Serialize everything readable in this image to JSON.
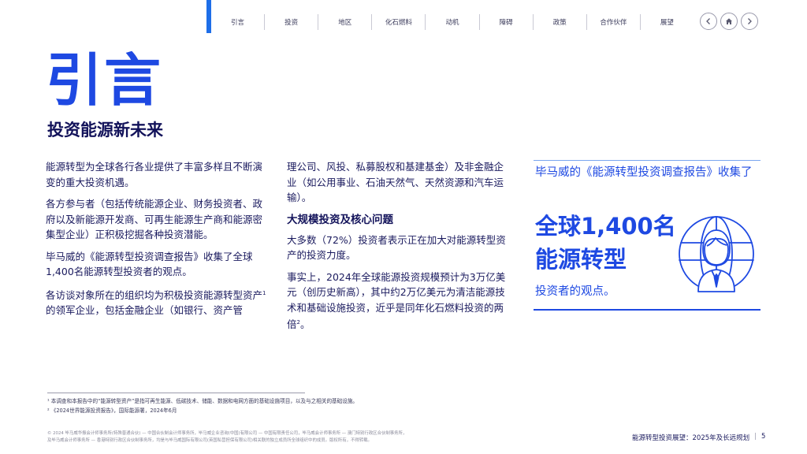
{
  "nav": {
    "items": [
      "引言",
      "投资",
      "地区",
      "化石燃料",
      "动机",
      "障碍",
      "政策",
      "合作伙伴",
      "展望"
    ]
  },
  "header": {
    "title": "引言",
    "subtitle": "投资能源新未来"
  },
  "column1": {
    "p1": "能源转型为全球各行各业提供了丰富多样且不断演变的重大投资机遇。",
    "p2": "各方参与者（包括传统能源企业、财务投资者、政府以及新能源开发商、可再生能源生产商和能源密集型企业）正积极挖掘各种投资潜能。",
    "p3": "毕马威的《能源转型投资调查报告》收集了全球1,400名能源转型投资者的观点。",
    "p4_a": "各访谈对象所在的组织均为积极投资能源转型资产",
    "p4_sup": "1",
    "p4_b": "的领军企业，包括金融企业（如银行、资产管"
  },
  "column2": {
    "p1": "理公司、风投、私募股权和基建基金）及非金融企业（如公用事业、石油天然气、天然资源和汽车运输）。",
    "heading": "大规模投资及核心问题",
    "p2": "大多数（72%）投资者表示正在加大对能源转型资产的投资力度。",
    "p3_a": "事实上，2024年全球能源投资规模预计为3万亿美元（创历史新高），其中约2万亿美元为清洁能源技术和基础设施投资，近乎是同年化石燃料投资的两倍",
    "p3_sup": "2",
    "p3_b": "。"
  },
  "highlight": {
    "intro": "毕马威的《能源转型投资调查报告》收集了",
    "big_line1": "全球1,400名",
    "big_line2": "能源转型",
    "outro": "投资者的观点。",
    "icon": "investor-globe-icon",
    "accent_color": "#1e49e2"
  },
  "footnotes": {
    "fn1": "¹ 本调查和本报告中的“能源转型资产”是指可再生能源、低碳技术、储能、数据和电网方面的基础设施项目，以及与之相关的基础设施。",
    "fn2": "² 《2024世界能源投资报告》，国际能源署，2024年6月"
  },
  "legal": {
    "line1": "© 2024 毕马威华振会计师事务所(特殊普通合伙) — 中国合伙制会计师事务所，毕马威企业咨询(中国)有限公司 — 中国有限责任公司，毕马威会计师事务所 — 澳门特别行政区合伙制事务所，",
    "line2": "及毕马威会计师事务所 — 香港特别行政区合伙制事务所，均是与毕马威国际有限公司(英国私营担保有限公司)相关联的独立成员所全球组织中的成员。版权所有，不得转载。"
  },
  "footer": {
    "doc_title": "能源转型投资展望：2025年及长远规划",
    "separator": "|",
    "page_number": "5"
  }
}
